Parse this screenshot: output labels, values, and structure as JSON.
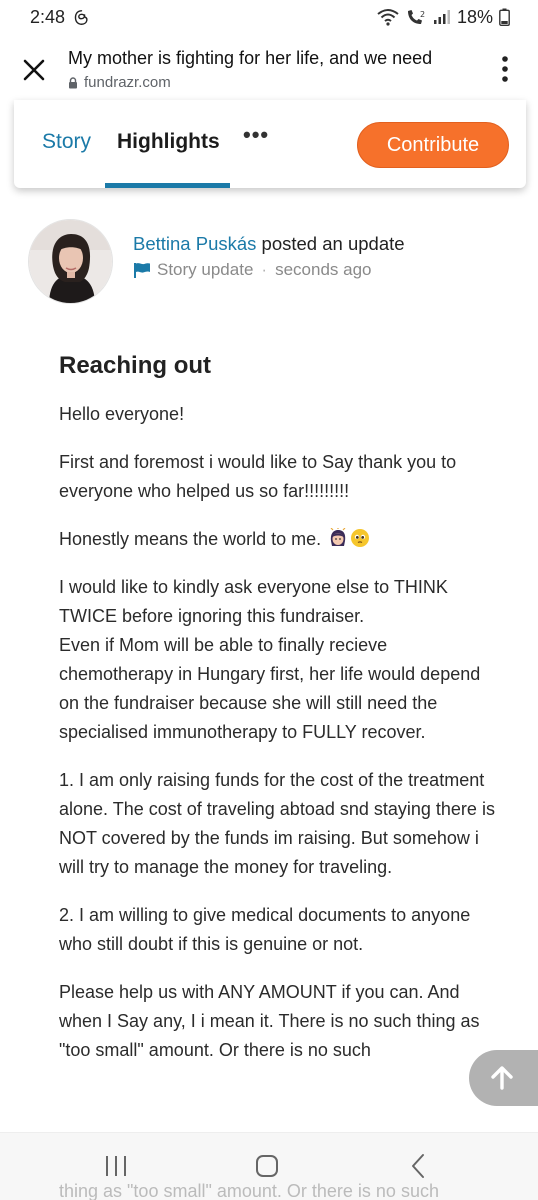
{
  "status_bar": {
    "time": "2:48",
    "battery": "18%",
    "app_icon": "threads-icon"
  },
  "browser": {
    "title": "My mother is fighting for her life, and we need",
    "url": "fundrazr.com"
  },
  "tabs": {
    "story": "Story",
    "highlights": "Highlights",
    "more": "•••",
    "contribute": "Contribute"
  },
  "post": {
    "author": "Bettina Puskás",
    "action": " posted an update",
    "type": "Story update",
    "time": "seconds ago",
    "title": "Reaching out",
    "paragraphs": {
      "p1": "Hello everyone!",
      "p2": "First and foremost i would like to Say thank you to everyone who helped us so far!!!!!!!!!",
      "p3": "Honestly means the world to me.",
      "p4a": "I would like to kindly ask everyone else to THINK TWICE before ignoring this fundraiser.",
      "p4b": "Even if Mom will be able to finally recieve chemotherapy in Hungary first, her life would depend on the fundraiser because she will still need the specialised immunotherapy to FULLY recover.",
      "p5": "1. I am only raising funds for the cost of the treatment alone. The cost of traveling abtoad snd staying there is NOT covered by the funds im raising. But somehow i will try to manage the money for traveling.",
      "p6": "2. I am willing to give medical documents to anyone who still doubt if this is genuine or not.",
      "p7": "Please help us with ANY AMOUNT if you can. And when I Say any, I i mean it. There is no such thing as \"too small\" amount. Or there is no such"
    },
    "bleed_text": "thing as \"too small\" amount. Or there is no such"
  },
  "colors": {
    "brand_blue": "#1b7aa8",
    "contribute_orange": "#f6712b"
  }
}
